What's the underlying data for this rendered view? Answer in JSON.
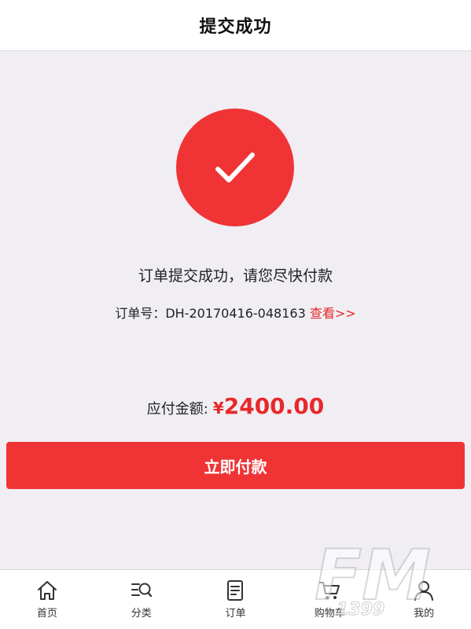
{
  "header": {
    "title": "提交成功"
  },
  "success": {
    "icon": "checkmark-icon",
    "accent_color": "#f03436",
    "message": "订单提交成功，请您尽快付款"
  },
  "order": {
    "label": "订单号：",
    "number": "DH-20170416-048163",
    "view_link": "查看>>"
  },
  "amount": {
    "label": "应付金额:",
    "currency": "¥",
    "value": "2400.00"
  },
  "pay_button": {
    "label": "立即付款"
  },
  "tabbar": {
    "items": [
      {
        "label": "首页",
        "icon": "home-icon"
      },
      {
        "label": "分类",
        "icon": "category-search-icon"
      },
      {
        "label": "订单",
        "icon": "order-icon"
      },
      {
        "label": "购物车",
        "icon": "cart-icon"
      },
      {
        "label": "我的",
        "icon": "user-icon"
      }
    ]
  },
  "watermark": {
    "text": "FM",
    "subtext": "1399"
  }
}
